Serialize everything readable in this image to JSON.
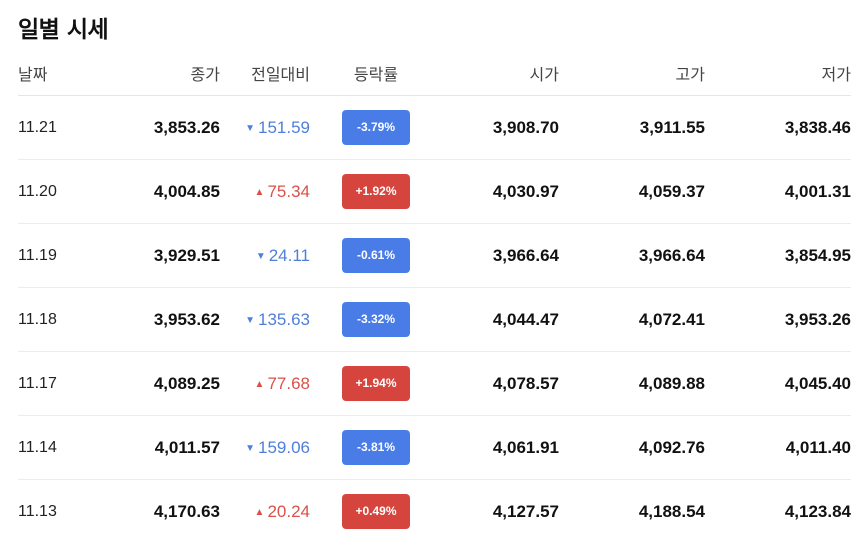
{
  "title": "일별 시세",
  "headers": {
    "date": "날짜",
    "close": "종가",
    "change": "전일대비",
    "rate": "등락률",
    "open": "시가",
    "high": "고가",
    "low": "저가"
  },
  "colors": {
    "down": "#4a7ce8",
    "up": "#d6453d"
  },
  "rows": [
    {
      "date": "11.21",
      "close": "3,853.26",
      "direction": "down",
      "arrow": "▼",
      "change": "151.59",
      "rate": "-3.79%",
      "open": "3,908.70",
      "high": "3,911.55",
      "low": "3,838.46"
    },
    {
      "date": "11.20",
      "close": "4,004.85",
      "direction": "up",
      "arrow": "▲",
      "change": "75.34",
      "rate": "+1.92%",
      "open": "4,030.97",
      "high": "4,059.37",
      "low": "4,001.31"
    },
    {
      "date": "11.19",
      "close": "3,929.51",
      "direction": "down",
      "arrow": "▼",
      "change": "24.11",
      "rate": "-0.61%",
      "open": "3,966.64",
      "high": "3,966.64",
      "low": "3,854.95"
    },
    {
      "date": "11.18",
      "close": "3,953.62",
      "direction": "down",
      "arrow": "▼",
      "change": "135.63",
      "rate": "-3.32%",
      "open": "4,044.47",
      "high": "4,072.41",
      "low": "3,953.26"
    },
    {
      "date": "11.17",
      "close": "4,089.25",
      "direction": "up",
      "arrow": "▲",
      "change": "77.68",
      "rate": "+1.94%",
      "open": "4,078.57",
      "high": "4,089.88",
      "low": "4,045.40"
    },
    {
      "date": "11.14",
      "close": "4,011.57",
      "direction": "down",
      "arrow": "▼",
      "change": "159.06",
      "rate": "-3.81%",
      "open": "4,061.91",
      "high": "4,092.76",
      "low": "4,011.40"
    },
    {
      "date": "11.13",
      "close": "4,170.63",
      "direction": "up",
      "arrow": "▲",
      "change": "20.24",
      "rate": "+0.49%",
      "open": "4,127.57",
      "high": "4,188.54",
      "low": "4,123.84"
    }
  ]
}
